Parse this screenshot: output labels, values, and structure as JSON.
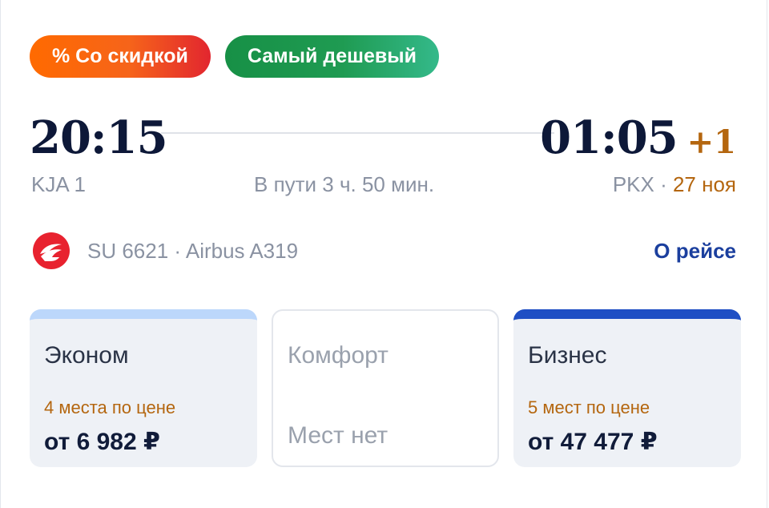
{
  "badges": {
    "discount": "% Со скидкой",
    "cheapest": "Самый дешевый"
  },
  "flight": {
    "departure_time": "20:15",
    "arrival_time": "01:05",
    "arrival_day_offset": "+1",
    "departure_airport": "KJA 1",
    "duration": "В пути 3 ч. 50 мин.",
    "arrival_airport": "PKX",
    "arrival_separator": " · ",
    "arrival_date": "27 ноя",
    "airline_icon": "airline-logo-icon",
    "flight_info": "SU 6621 · Airbus A319",
    "about_link": "О рейсе"
  },
  "fares": {
    "economy": {
      "name": "Эконом",
      "seats": "4 места по цене",
      "price": "от 6 982 ₽"
    },
    "comfort": {
      "name": "Комфорт",
      "empty": "Мест нет"
    },
    "business": {
      "name": "Бизнес",
      "seats": "5 мест по цене",
      "price": "от 47 477 ₽"
    }
  },
  "colors": {
    "accent_orange": "#b4660f",
    "link_blue": "#1b3f9e",
    "airline_red": "#e8222f",
    "economy_bar": "#bcd7fb",
    "business_bar": "#1f4fc4"
  }
}
